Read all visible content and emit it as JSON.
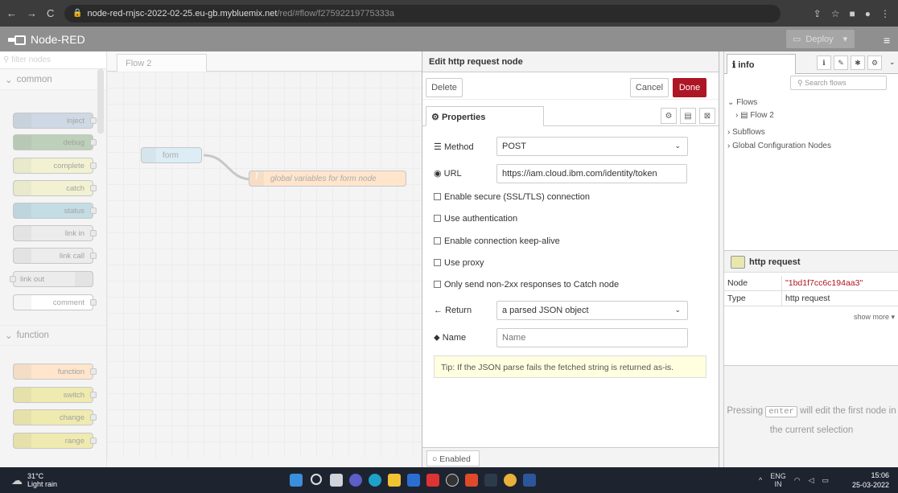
{
  "browser": {
    "url_host": "node-red-rnjsc-2022-02-25.eu-gb.mybluemix.net",
    "url_path": "/red/#flow/f27592219775333a"
  },
  "header": {
    "app_title": "Node-RED",
    "deploy_label": "Deploy"
  },
  "palette": {
    "filter_placeholder": "filter nodes",
    "categories": [
      "common",
      "function"
    ],
    "nodes": [
      {
        "label": "inject",
        "color": "#a6bbcf",
        "icon": "arrow-icon"
      },
      {
        "label": "debug",
        "color": "#87a980",
        "icon": "list-icon"
      },
      {
        "label": "complete",
        "color": "#e8e8ae",
        "icon": "exclamation-icon"
      },
      {
        "label": "catch",
        "color": "#e8e8ae",
        "icon": "exclamation-icon"
      },
      {
        "label": "status",
        "color": "#94c1d0",
        "icon": "pulse-icon"
      },
      {
        "label": "link in",
        "color": "#dddddd",
        "icon": "link-icon"
      },
      {
        "label": "link call",
        "color": "#dddddd",
        "icon": "link-icon"
      },
      {
        "label": "link out",
        "color": "#dddddd",
        "icon": "link-icon"
      },
      {
        "label": "comment",
        "color": "#ffffff",
        "icon": "comment-icon"
      },
      {
        "label": "function",
        "color": "#fdd0a2",
        "icon": "function-icon"
      },
      {
        "label": "switch",
        "color": "#e2d96e",
        "icon": "switch-icon"
      },
      {
        "label": "change",
        "color": "#e2d96e",
        "icon": "change-icon"
      },
      {
        "label": "range",
        "color": "#e2d96e",
        "icon": "range-icon"
      }
    ]
  },
  "workspace": {
    "tab": "Flow 2",
    "flow_nodes": [
      {
        "label": "form"
      },
      {
        "label": "global variables for form node"
      }
    ]
  },
  "editor": {
    "title": "Edit http request node",
    "delete": "Delete",
    "cancel": "Cancel",
    "done": "Done",
    "properties_tab": "Properties",
    "method_label": "Method",
    "method_value": "POST",
    "url_label": "URL",
    "url_value": "https://iam.cloud.ibm.com/identity/token",
    "checks": [
      "Enable secure (SSL/TLS) connection",
      "Use authentication",
      "Enable connection keep-alive",
      "Use proxy",
      "Only send non-2xx responses to Catch node"
    ],
    "return_label": "Return",
    "return_value": "a parsed JSON object",
    "name_label": "Name",
    "name_placeholder": "Name",
    "tip": "Tip: If the JSON parse fails the fetched string is returned as-is.",
    "enabled": "Enabled"
  },
  "sidebar": {
    "tab": "info",
    "search_placeholder": "Search flows",
    "tree": {
      "flows": "Flows",
      "flow2": "Flow 2",
      "subflows": "Subflows",
      "global": "Global Configuration Nodes"
    },
    "node_title": "http request",
    "rows": [
      {
        "k": "Node",
        "v": "\"1bd1f7cc6c194aa3\""
      },
      {
        "k": "Type",
        "v": "http request"
      }
    ],
    "show_more": "show more",
    "help_pre": "Pressing",
    "help_key": "enter",
    "help_post": "will edit the first node in the current selection"
  },
  "taskbar": {
    "temp": "31°C",
    "weather": "Light rain",
    "lang": "ENG",
    "region": "IN",
    "time": "15:06",
    "date": "25-03-2022"
  }
}
